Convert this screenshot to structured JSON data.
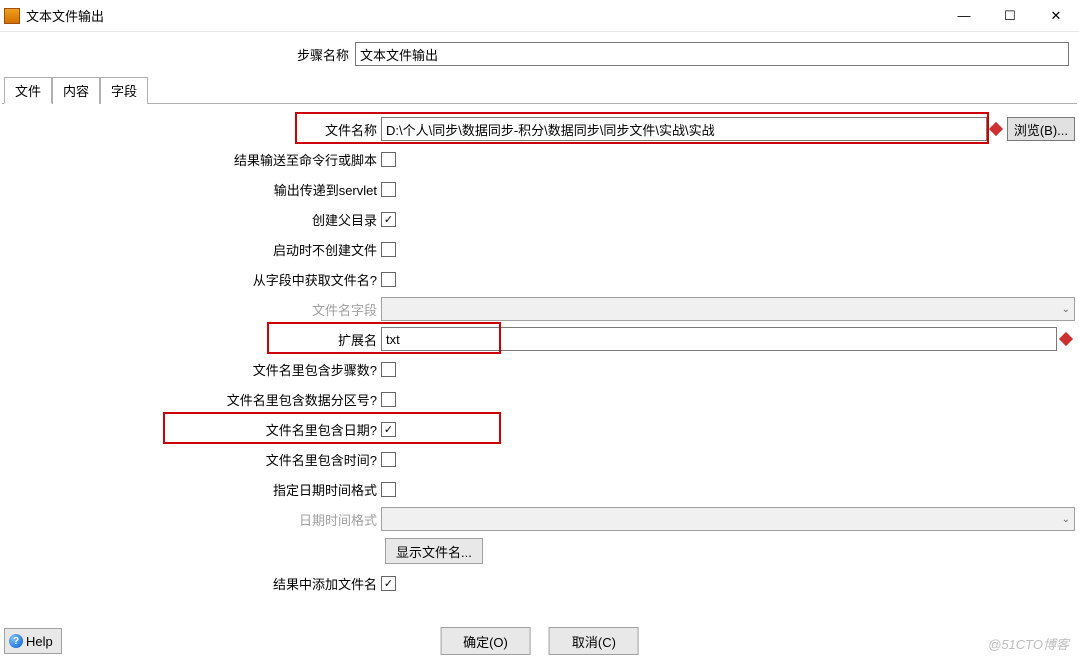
{
  "window": {
    "title": "文本文件输出",
    "minimize": "—",
    "maximize": "☐",
    "close": "✕"
  },
  "step_name": {
    "label": "步骤名称",
    "value": "文本文件输出"
  },
  "tabs": {
    "file": "文件",
    "content": "内容",
    "fields": "字段"
  },
  "form": {
    "file_name_label": "文件名称",
    "file_name_value": "D:\\个人\\同步\\数据同步-积分\\数据同步\\同步文件\\实战\\实战",
    "browse_label": "浏览(B)...",
    "output_to_cmd_label": "结果输送至命令行或脚本",
    "output_to_servlet_label": "输出传递到servlet",
    "create_parent_label": "创建父目录",
    "no_create_on_start_label": "启动时不创建文件",
    "get_fn_from_field_label": "从字段中获取文件名?",
    "fn_field_label": "文件名字段",
    "extension_label": "扩展名",
    "extension_value": "txt",
    "include_step_label": "文件名里包含步骤数?",
    "include_partition_label": "文件名里包含数据分区号?",
    "include_date_label": "文件名里包含日期?",
    "include_time_label": "文件名里包含时间?",
    "specify_format_label": "指定日期时间格式",
    "date_format_label": "日期时间格式",
    "show_filename_btn": "显示文件名...",
    "add_fn_to_result_label": "结果中添加文件名"
  },
  "checks": {
    "output_to_cmd": false,
    "output_to_servlet": false,
    "create_parent": true,
    "no_create_on_start": false,
    "get_fn_from_field": false,
    "include_step": false,
    "include_partition": false,
    "include_date": true,
    "include_time": false,
    "specify_format": false,
    "add_fn_to_result": true
  },
  "buttons": {
    "help": "Help",
    "ok": "确定(O)",
    "cancel": "取消(C)"
  },
  "watermark": "@51CTO博客"
}
